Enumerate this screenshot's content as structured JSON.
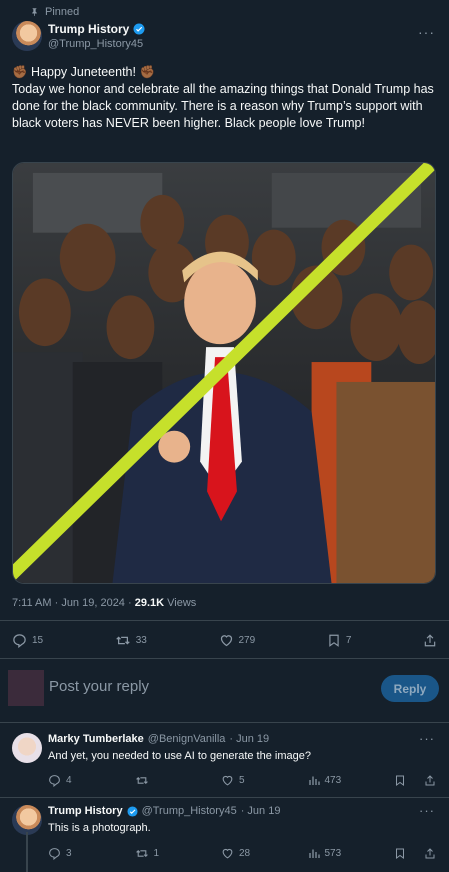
{
  "post": {
    "pinned_label": "Pinned",
    "author": {
      "name": "Trump History",
      "handle": "@Trump_History45"
    },
    "text_lines": [
      "✊🏾 Happy Juneteenth! ✊🏾",
      "Today we honor and celebrate all the amazing things that Donald Trump has done for the black community. There is a reason why Trump’s support with black voters has NEVER been higher. Black people love Trump!"
    ],
    "time": "7:11 AM · Jun 19, 2024 · ",
    "views_count": "29.1K",
    "views_label": " Views",
    "stats": {
      "replies": "15",
      "reposts": "33",
      "likes": "279",
      "bookmarks": "7"
    }
  },
  "reply_box": {
    "placeholder": "Post your reply",
    "button": "Reply"
  },
  "replies": [
    {
      "name": "Marky Tumberlake",
      "handle": "@BenignVanilla",
      "date": "· Jun 19",
      "text": "And yet, you needed to use AI to generate the image?",
      "stats": {
        "replies": "4",
        "reposts": "",
        "likes": "5",
        "views": "473"
      }
    },
    {
      "name": "Trump History",
      "handle": "@Trump_History45",
      "date": "· Jun 19",
      "text": "This is a photograph.",
      "stats": {
        "replies": "3",
        "reposts": "1",
        "likes": "28",
        "views": "573"
      }
    }
  ],
  "colors": {
    "background": "#15202b",
    "accent": "#1d9bf0",
    "slash": "#c6e02b",
    "verified": "#1d9bf0"
  },
  "icons": [
    "pin-icon",
    "verified-icon",
    "more-icon",
    "reply-icon",
    "repost-icon",
    "like-icon",
    "bookmark-icon",
    "share-icon",
    "views-icon"
  ]
}
